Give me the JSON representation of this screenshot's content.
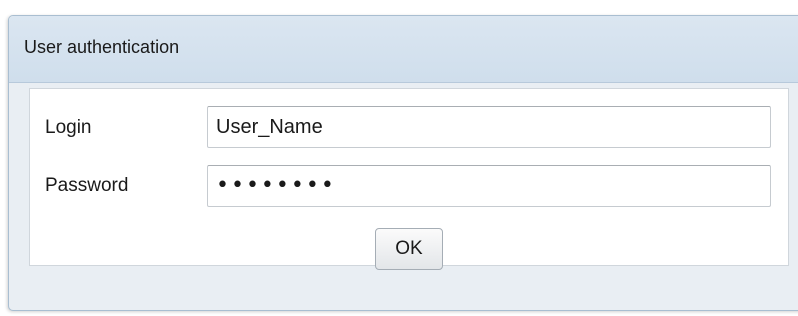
{
  "dialog": {
    "title": "User authentication"
  },
  "form": {
    "login": {
      "label": "Login",
      "value": "User_Name"
    },
    "password": {
      "label": "Password",
      "masked_value": "••••••••",
      "length": 8
    },
    "ok_label": "OK"
  }
}
